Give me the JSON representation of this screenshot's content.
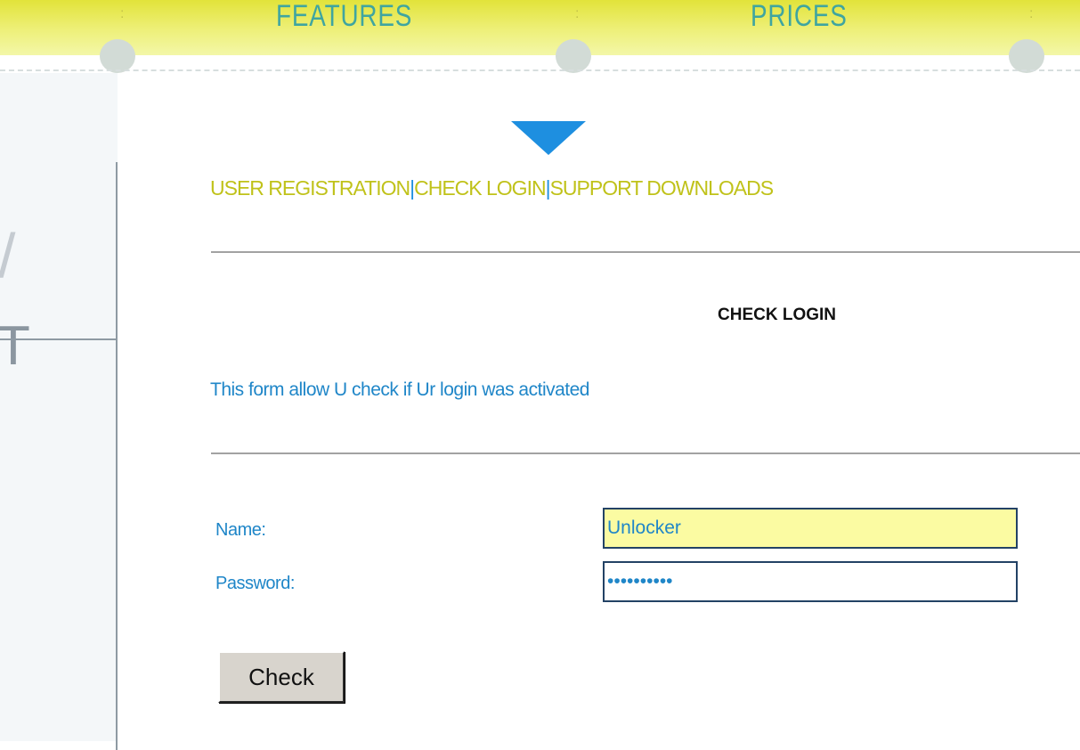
{
  "topnav": {
    "items": [
      {
        "label": "FEATURES"
      },
      {
        "label": "PRICES"
      }
    ]
  },
  "left_panel": {
    "glyph_top": "/",
    "glyph_bottom": "T"
  },
  "subnav": {
    "items": [
      {
        "label": "USER REGISTRATION"
      },
      {
        "label": "CHECK LOGIN"
      },
      {
        "label": "SUPPORT DOWNLOADS"
      }
    ],
    "separator": "|"
  },
  "form": {
    "title": "CHECK LOGIN",
    "description": "This form allow U check if Ur login was activated",
    "name_label": "Name:",
    "name_value": "Unlocker",
    "password_label": "Password:",
    "password_value": "••••••••••",
    "submit_label": "Check"
  },
  "colors": {
    "topbar": "#e2e33a",
    "link": "#c0c21a",
    "accent_blue": "#1e8fe0",
    "text_blue": "#1f86c8",
    "input_highlight": "#fbfba2"
  },
  "icons": {
    "down_arrow": "down-arrow-icon"
  }
}
